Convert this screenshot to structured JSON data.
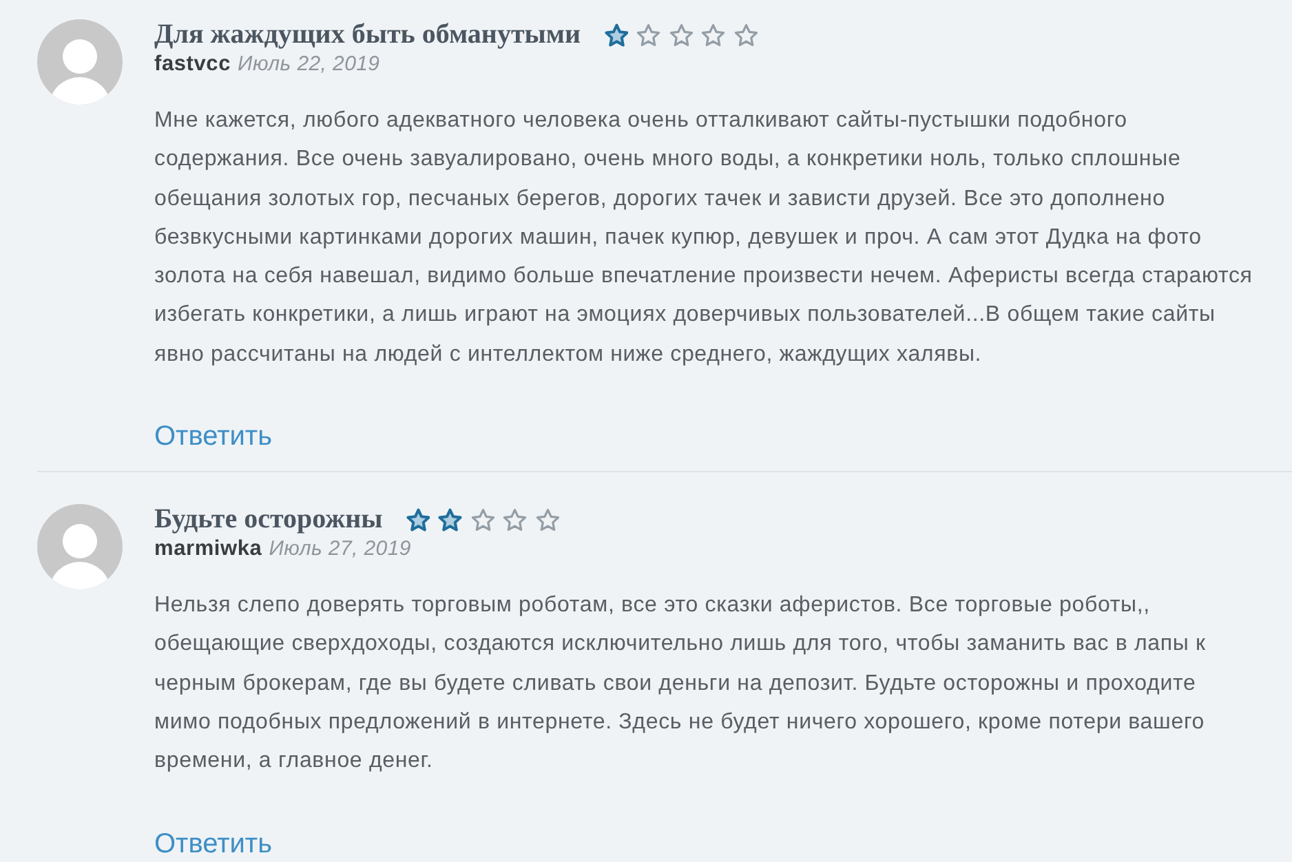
{
  "comments": [
    {
      "title": "Для жаждущих быть обманутыми",
      "stars": 1,
      "author": "fastvcc",
      "date": "Июль 22, 2019",
      "text": "Мне кажется, любого адекватного человека очень отталкивают сайты-пустышки подобного содержания. Все очень завуалировано, очень много воды, а конкретики ноль, только сплошные обещания золотых гор, песчаных берегов, дорогих тачек и зависти друзей. Все это дополнено безвкусными картинками дорогих машин, пачек купюр, девушек и проч. А сам этот Дудка на фото золота на себя навешал, видимо больше впечатление произвести нечем. Аферисты всегда стараются избегать конкретики, а лишь играют на эмоциях доверчивых пользователей...В общем такие сайты явно рассчитаны на людей с интеллектом ниже среднего, жаждущих халявы.",
      "reply": "Ответить"
    },
    {
      "title": "Будьте осторожны",
      "stars": 2,
      "author": "marmiwka",
      "date": "Июль 27, 2019",
      "text": "Нельзя слепо доверять торговым роботам, все это сказки аферистов. Все торговые роботы,, обещающие сверхдоходы, создаются исключительно лишь для того, чтобы заманить вас в лапы к черным брокерам, где вы будете сливать свои деньги на депозит. Будьте осторожны и проходите мимо подобных предложений в интернете. Здесь не будет ничего хорошего, кроме потери вашего времени, а главное денег.",
      "reply": "Ответить"
    }
  ]
}
